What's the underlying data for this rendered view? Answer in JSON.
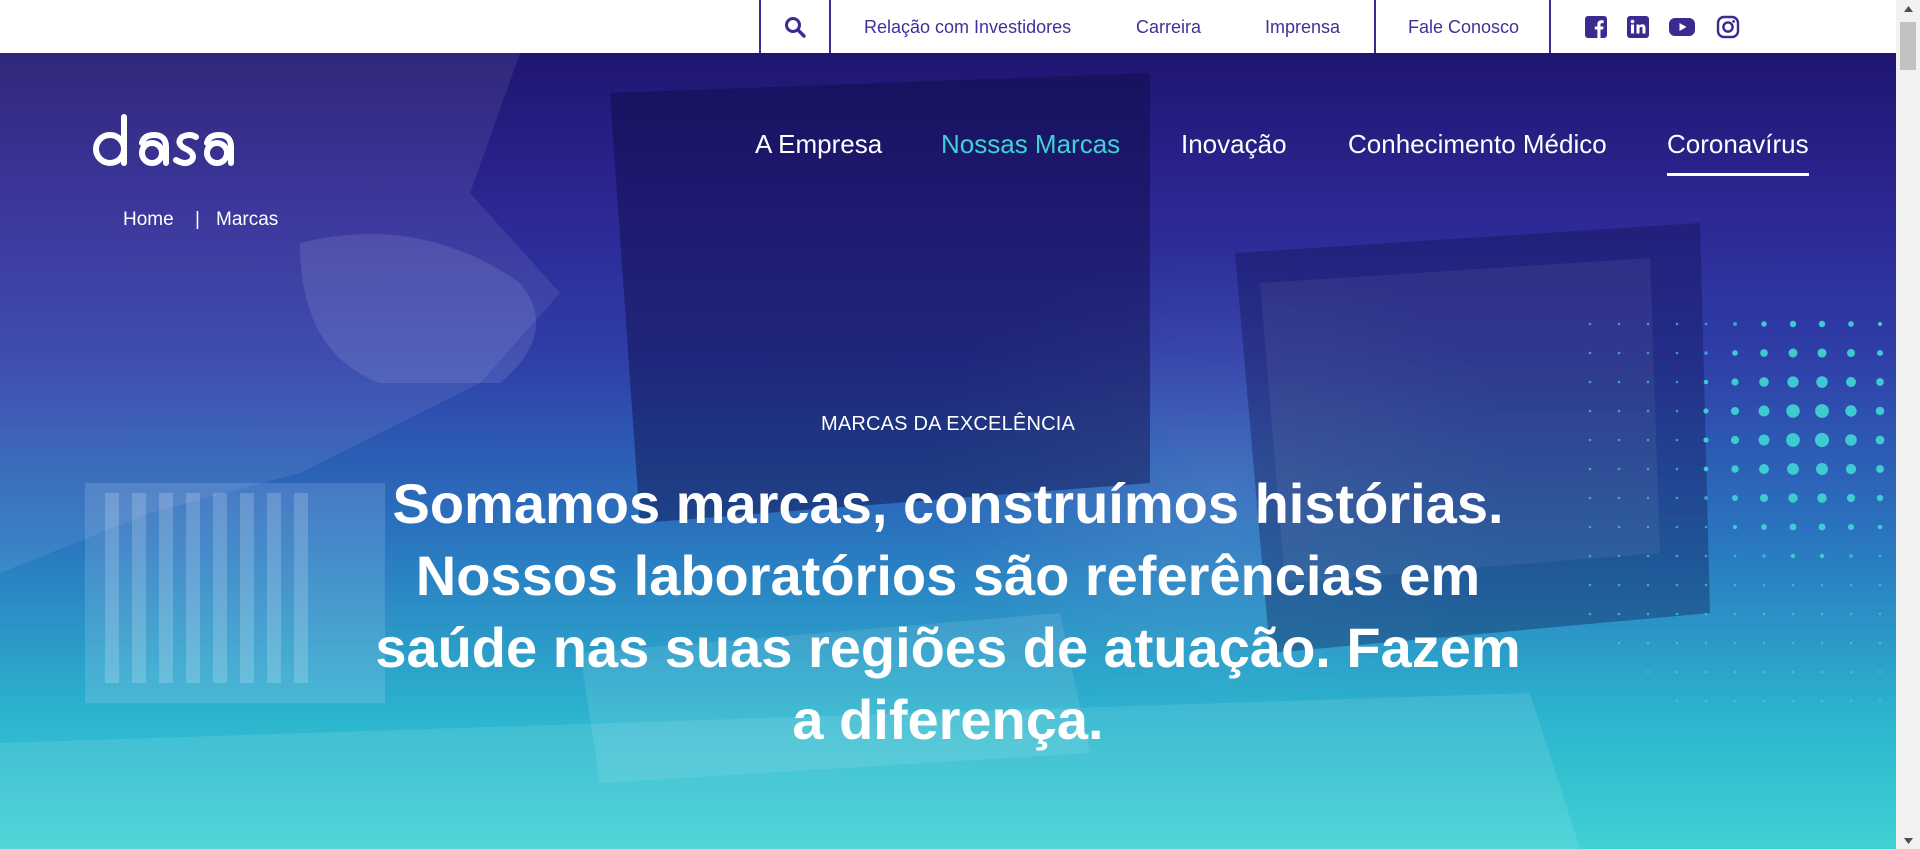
{
  "topbar": {
    "search_icon": "search-icon",
    "links": [
      "Relação com Investidores",
      "Carreira",
      "Imprensa",
      "Fale Conosco"
    ],
    "social": [
      "facebook-icon",
      "linkedin-icon",
      "youtube-icon",
      "instagram-icon"
    ],
    "color": "#40309a"
  },
  "logo": {
    "text": "dasa"
  },
  "nav": {
    "items": [
      "A Empresa",
      "Nossas Marcas",
      "Inovação",
      "Conhecimento Médico",
      "Coronavírus"
    ],
    "active_color": "#3fd1d3"
  },
  "breadcrumb": {
    "home": "Home",
    "separator": "|",
    "current": "Marcas"
  },
  "hero": {
    "eyebrow": "MARCAS DA EXCELÊNCIA",
    "headline_lines": [
      "Somamos marcas, construímos histórias.",
      "Nossos laboratórios são referências em",
      "saúde nas suas regiões de atuação. Fazem",
      "a diferença."
    ],
    "accent_color": "#3fd1d3"
  },
  "scrollbar": {
    "up_icon": "arrow-up-icon",
    "down_icon": "arrow-down-icon"
  }
}
